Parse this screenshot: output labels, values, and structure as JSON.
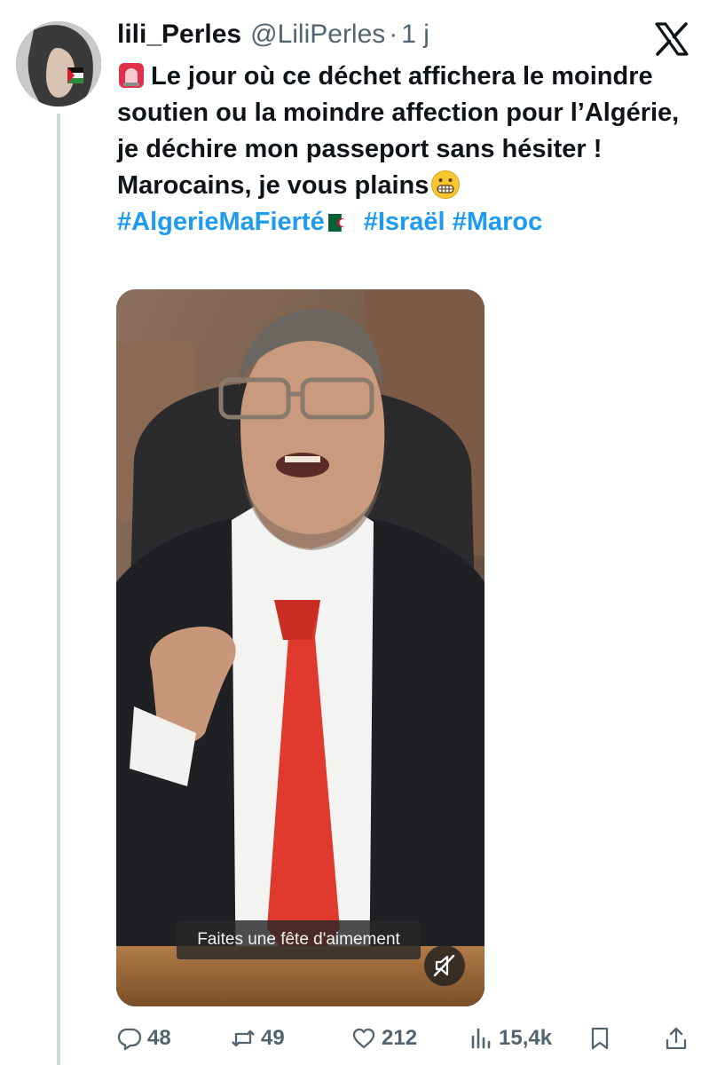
{
  "tweet": {
    "author_name": "lili_Perles",
    "author_handle": "@LiliPerles",
    "separator": "·",
    "time": "1 j",
    "text_lines": [
      "Le jour où ce déchet affichera le moindre soutien ou la moindre affection pour l’Algérie, je déchire mon passeport sans hésiter !",
      "Marocains, je vous plains"
    ],
    "hashtags": [
      "#AlgerieMaFierté",
      "#Israël",
      "#Maroc"
    ]
  },
  "video": {
    "caption": "Faites une fête d'aimement",
    "muted": true
  },
  "actions": {
    "replies": "48",
    "reposts": "49",
    "likes": "212",
    "views": "15,4k"
  },
  "icons": {
    "logo": "x-logo-icon",
    "reply": "reply-icon",
    "repost": "repost-icon",
    "like": "heart-icon",
    "views": "views-icon",
    "bookmark": "bookmark-icon",
    "share": "share-icon",
    "mute": "speaker-muted-icon"
  },
  "colors": {
    "link": "#1d9bf0",
    "secondary_text": "#536471",
    "primary_text": "#0f1419"
  }
}
